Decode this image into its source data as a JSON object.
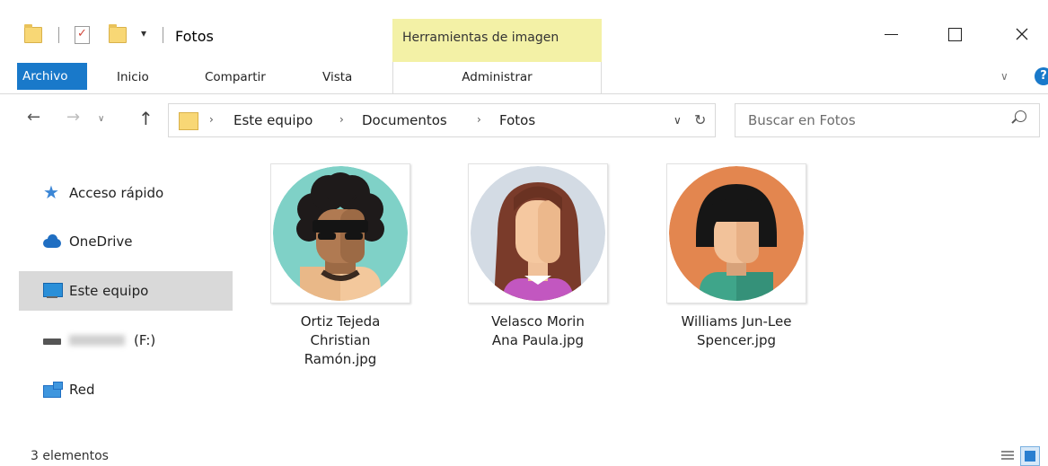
{
  "window": {
    "title": "Fotos",
    "context_tab": "Herramientas de imagen",
    "qat_caret": "▾"
  },
  "ribbon": {
    "tabs": [
      "Archivo",
      "Inicio",
      "Compartir",
      "Vista",
      "Administrar"
    ],
    "active_tab": "Archivo",
    "chevron": "∨",
    "help": "?"
  },
  "nav": {
    "back": "←",
    "forward": "→",
    "recent": "∨",
    "up": "↑",
    "breadcrumb": [
      "Este equipo",
      "Documentos",
      "Fotos"
    ],
    "crumb_sep": "›",
    "dropdown": "∨",
    "refresh": "↻",
    "search_placeholder": "Buscar en Fotos"
  },
  "sidebar": {
    "items": [
      {
        "label": "Acceso rápido",
        "icon": "star-icon"
      },
      {
        "label": "OneDrive",
        "icon": "cloud-icon"
      },
      {
        "label": "Este equipo",
        "icon": "computer-icon",
        "selected": true
      },
      {
        "label": "(F:)",
        "icon": "drive-icon"
      },
      {
        "label": "Red",
        "icon": "network-icon"
      }
    ]
  },
  "files": [
    {
      "lines": [
        "Ortiz Tejeda",
        "Christian",
        "Ramón.jpg"
      ],
      "avatar": "afro-sunglasses-avatar"
    },
    {
      "lines": [
        "Velasco Morin",
        "Ana Paula.jpg"
      ],
      "avatar": "long-hair-avatar"
    },
    {
      "lines": [
        "Williams Jun-Lee",
        "Spencer.jpg"
      ],
      "avatar": "bowl-cut-avatar"
    }
  ],
  "status": {
    "count": "3 elementos"
  },
  "colors": {
    "accent": "#1979ca",
    "context_tab": "#f3f1a6",
    "selected": "#d9d9d9"
  }
}
